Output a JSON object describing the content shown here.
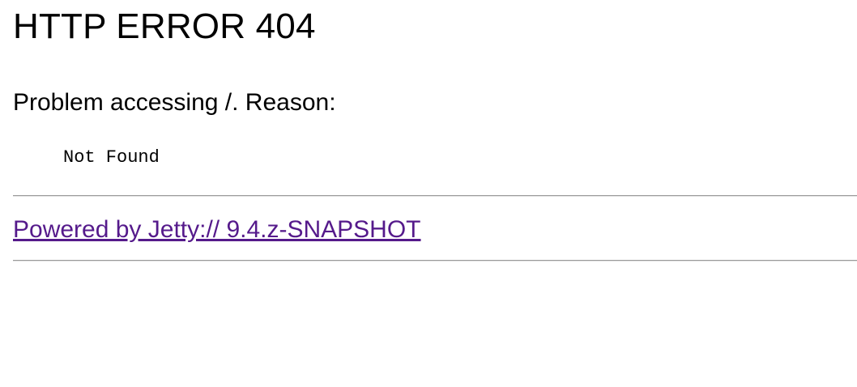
{
  "error": {
    "title": "HTTP ERROR 404",
    "problem_text": "Problem accessing /. Reason:",
    "reason": "Not Found"
  },
  "footer": {
    "powered_by_link": "Powered by Jetty:// 9.4.z-SNAPSHOT"
  },
  "colors": {
    "link_visited": "#551a8b",
    "text": "#000000",
    "rule": "#9a9a9a"
  }
}
